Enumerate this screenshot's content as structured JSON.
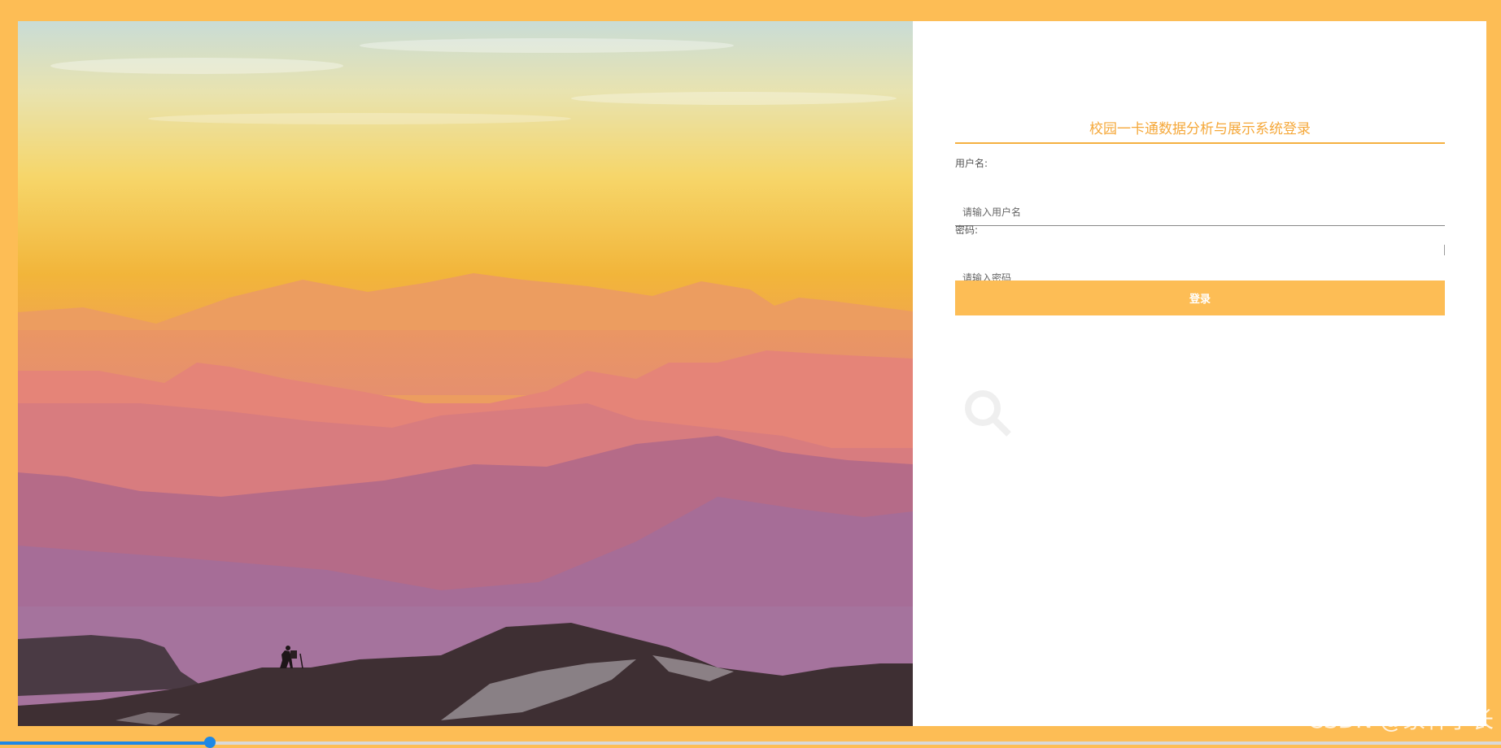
{
  "login": {
    "title": "校园一卡通数据分析与展示系统登录",
    "username_label": "用户名:",
    "username_placeholder": "请输入用户名",
    "password_label": "密码:",
    "password_placeholder": "请输入密码",
    "submit_label": "登录"
  },
  "watermark": "CSDN @家林学长",
  "colors": {
    "frame": "#FDBD55",
    "accent": "#F5A83A",
    "button": "#FDBD55",
    "progress": "#1E88E5"
  },
  "video_progress": {
    "fraction": 0.14
  }
}
